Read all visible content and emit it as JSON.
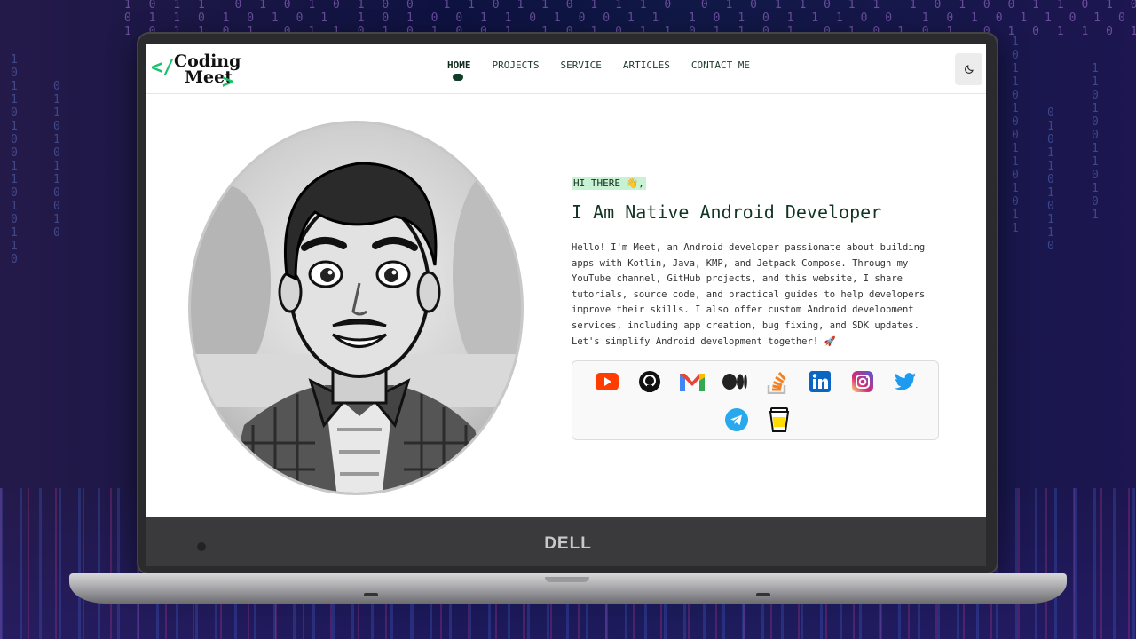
{
  "nav": {
    "logo_line1": "Coding",
    "logo_line2": "Meet",
    "links": [
      "HOME",
      "PROJECTS",
      "SERVICE",
      "ARTICLES",
      "CONTACT ME"
    ],
    "active": "HOME"
  },
  "hero": {
    "greeting": "HI THERE 👋,",
    "title": "I Am Native Android Developer",
    "description": "Hello! I'm Meet, an Android developer passionate about building apps with Kotlin, Java, KMP, and Jetpack Compose. Through my YouTube channel, GitHub projects, and this website, I share tutorials, source code, and practical guides to help developers improve their skills. I also offer custom Android development services, including app creation, bug fixing, and SDK updates. Let's simplify Android development together! 🚀"
  },
  "social_icons": [
    "youtube-icon",
    "github-icon",
    "gmail-icon",
    "medium-icon",
    "stackoverflow-icon",
    "linkedin-icon",
    "instagram-icon",
    "twitter-icon",
    "telegram-icon",
    "buymeacoffee-icon"
  ],
  "device_brand": "DELL",
  "colors": {
    "accent": "#19c26b",
    "nav_active": "#123d28",
    "title": "#123523",
    "greeting_bg": "#c7f2d3"
  }
}
